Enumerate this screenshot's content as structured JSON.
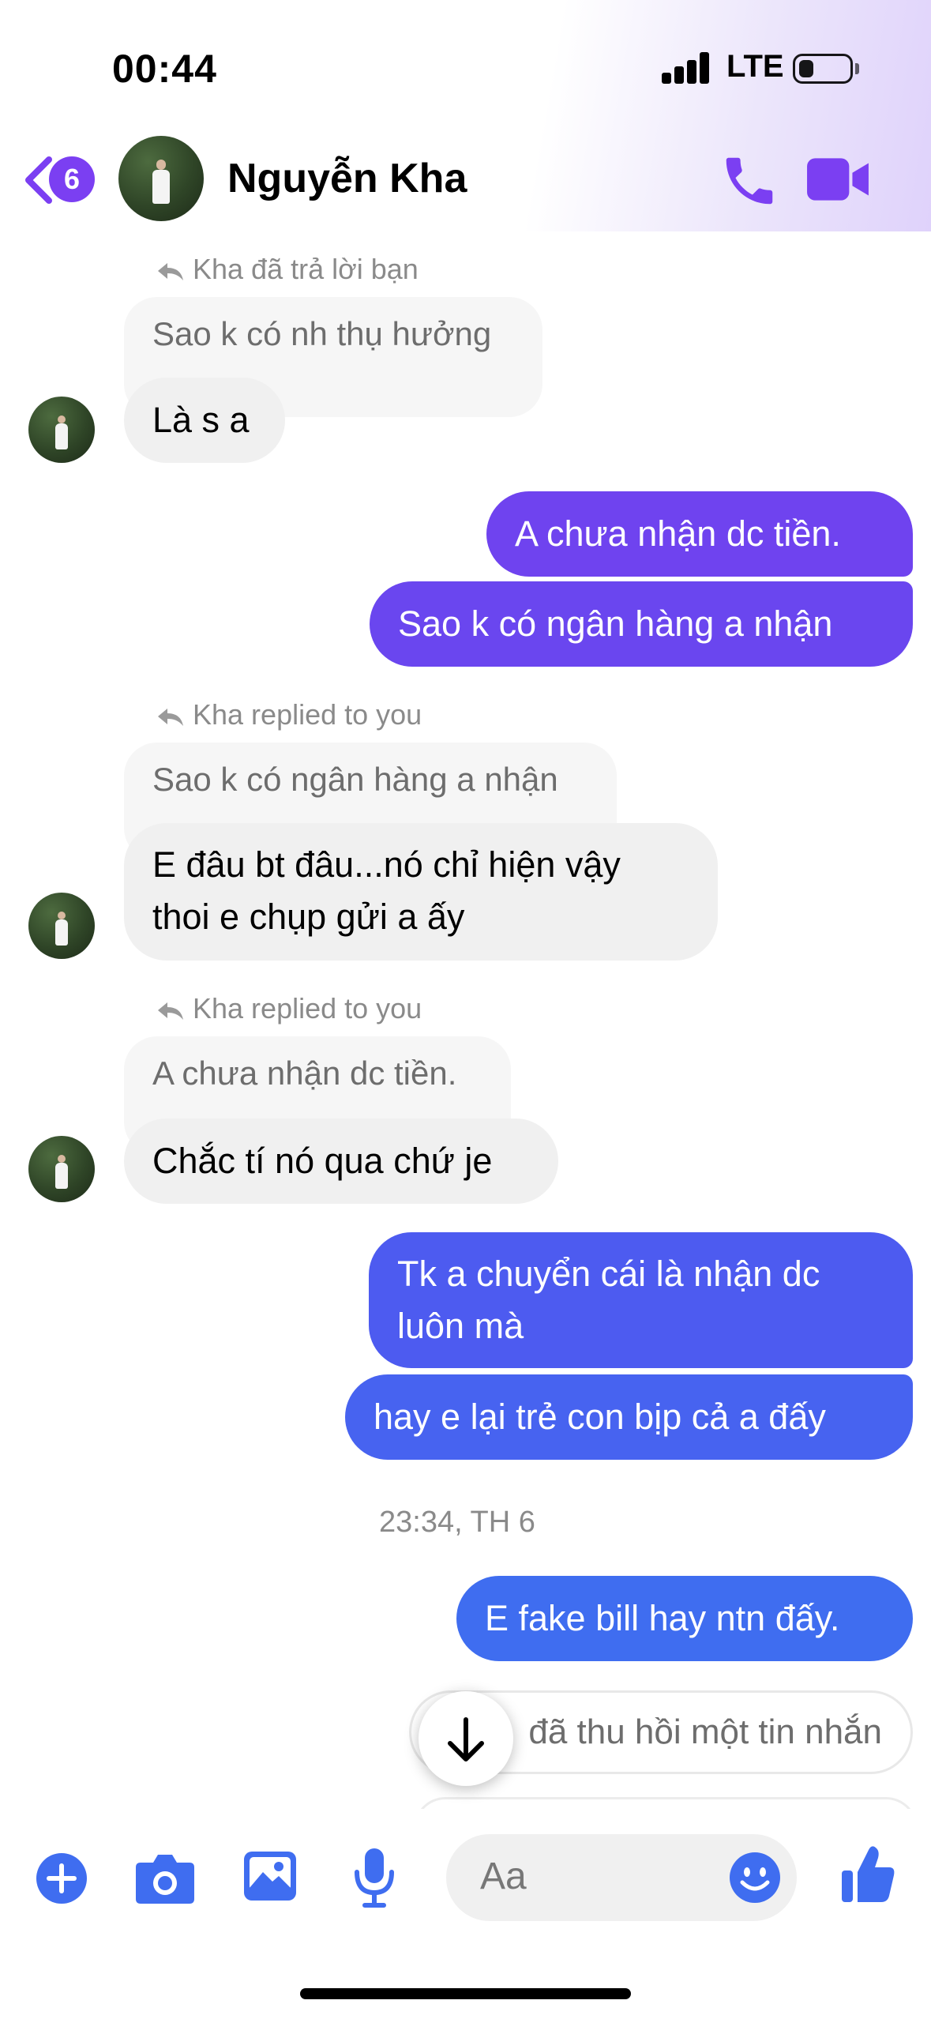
{
  "status_bar": {
    "time": "00:44",
    "network": "LTE"
  },
  "header": {
    "back_badge": "6",
    "contact_name": "Nguyễn Kha",
    "icons": [
      "back-chevron-icon",
      "phone-icon",
      "video-camera-icon"
    ]
  },
  "messages": {
    "reply1_header": "Kha đã trả lời bạn",
    "reply1_quote": "Sao k có nh thụ hưởng",
    "reply1_text": "Là s a",
    "out1": "A chưa nhận dc tiền.",
    "out2": "Sao k có ngân hàng a nhận",
    "reply2_header": "Kha replied to you",
    "reply2_quote": "Sao k có ngân hàng a nhận",
    "reply2_line1": "E đâu bt đâu...nó chỉ hiện vậy",
    "reply2_line2": "thoi e chụp gửi a ấy",
    "reply3_header": "Kha replied to you",
    "reply3_quote": "A chưa nhận dc tiền.",
    "reply3_text": "Chắc tí nó qua chứ je",
    "out3_line1": "Tk a chuyển cái là nhận dc",
    "out3_line2": "luôn mà",
    "out4": "hay e lại trẻ con bịp cả a đấy",
    "timestamp": "23:34, TH 6",
    "out5": "E fake bill hay ntn đấy.",
    "unsent": "đã thu hồi một tin nhắn"
  },
  "composer": {
    "placeholder": "Aa",
    "icons": [
      "plus-icon",
      "camera-icon",
      "gallery-icon",
      "microphone-icon",
      "emoji-icon",
      "thumbs-up-icon"
    ]
  },
  "colors": {
    "accent_purple": "#7b3ff2",
    "bubble_violet": "#6f43ef",
    "bubble_indigo": "#5a54ef",
    "bubble_blue": "#4b5ff0",
    "composer_blue": "#3f6df0"
  }
}
